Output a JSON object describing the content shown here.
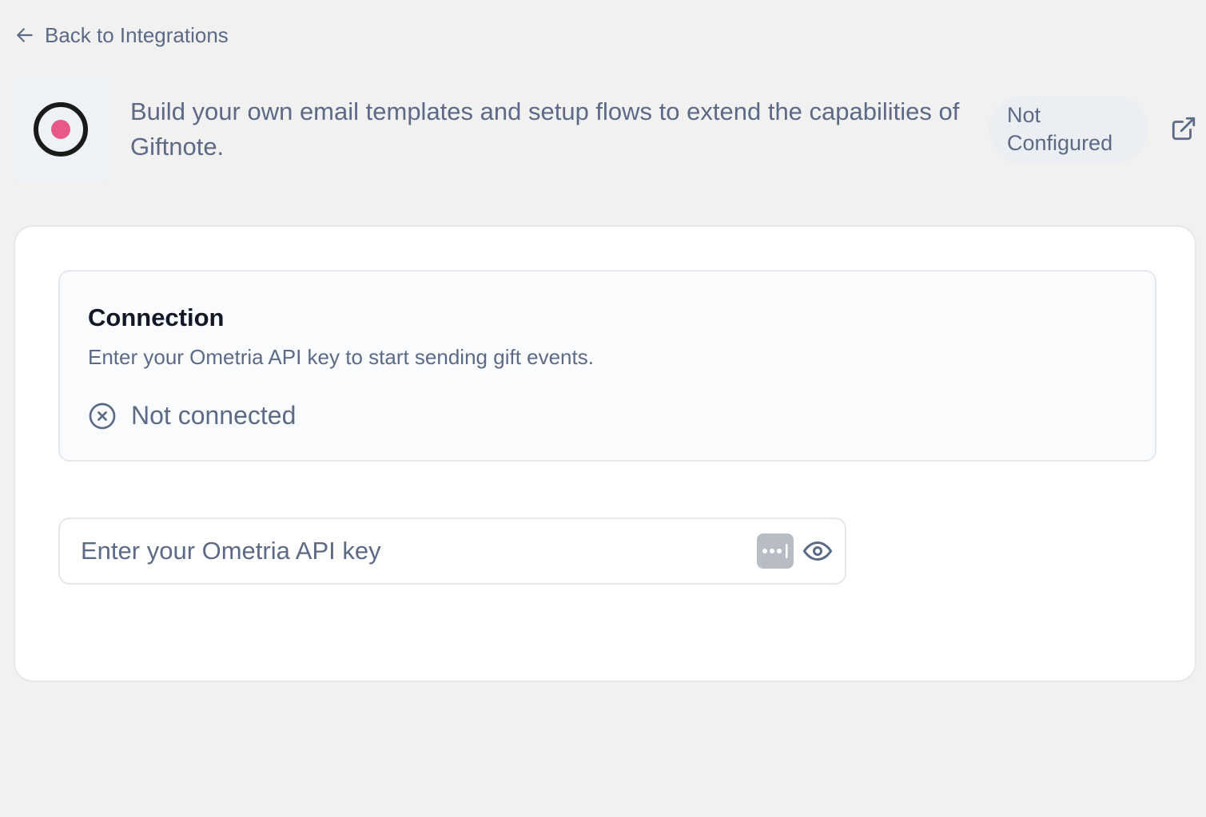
{
  "navigation": {
    "back_label": "Back to Integrations",
    "back_icon": "arrow-left-icon"
  },
  "integration": {
    "logo_icon": "ring-with-pink-dot-logo",
    "description": "Build your own email templates and setup flows to extend the capabilities of Giftnote.",
    "status_label": "Not Configured",
    "external_link_icon": "external-link-icon"
  },
  "connection": {
    "title": "Connection",
    "description": "Enter your Ometria API key to start sending gift events.",
    "status_text": "Not connected",
    "status_icon": "circle-x-icon"
  },
  "api_key_field": {
    "value": "",
    "placeholder": "Enter your Ometria API key",
    "password_manager_icon": "password-manager-icon",
    "visibility_icon": "eye-icon"
  },
  "colors": {
    "page_background": "#f1f1f1",
    "text_muted": "#5c6a85",
    "text_heading": "#111827",
    "logo_accent": "#e8598a",
    "border": "#e4e7ec"
  }
}
